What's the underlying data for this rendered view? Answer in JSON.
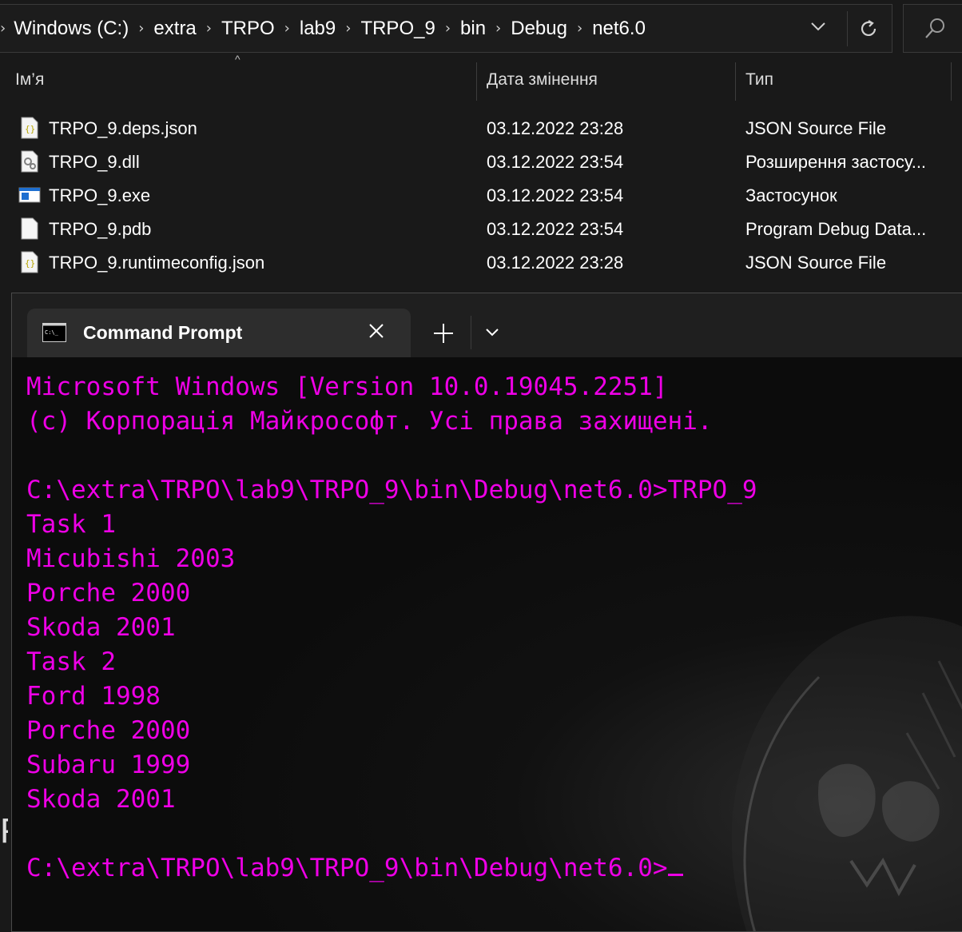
{
  "explorer": {
    "breadcrumbs": [
      "Windows (C:)",
      "extra",
      "TRPO",
      "lab9",
      "TRPO_9",
      "bin",
      "Debug",
      "net6.0"
    ],
    "columns": {
      "name": "Ім’я",
      "date": "Дата змінення",
      "type": "Тип"
    },
    "files": [
      {
        "name": "TRPO_9.deps.json",
        "date": "03.12.2022 23:28",
        "type": "JSON Source File",
        "icon": "json-file-icon"
      },
      {
        "name": "TRPO_9.dll",
        "date": "03.12.2022 23:54",
        "type": "Розширення застосу...",
        "icon": "dll-file-icon"
      },
      {
        "name": "TRPO_9.exe",
        "date": "03.12.2022 23:54",
        "type": "Застосунок",
        "icon": "exe-file-icon"
      },
      {
        "name": "TRPO_9.pdb",
        "date": "03.12.2022 23:54",
        "type": "Program Debug Data...",
        "icon": "blank-file-icon"
      },
      {
        "name": "TRPO_9.runtimeconfig.json",
        "date": "03.12.2022 23:28",
        "type": "JSON Source File",
        "icon": "json-file-icon"
      }
    ]
  },
  "terminal": {
    "tab_title": "Command Prompt",
    "text_color": "#ee00e6",
    "lines": [
      "Microsoft Windows [Version 10.0.19045.2251]",
      "(c) Корпорація Майкрософт. Усі права захищені.",
      "",
      "C:\\extra\\TRPO\\lab9\\TRPO_9\\bin\\Debug\\net6.0>TRPO_9",
      "Task 1",
      "Micubishi 2003",
      "Porche 2000",
      "Skoda 2001",
      "Task 2",
      "Ford 1998",
      "Porche 2000",
      "Subaru 1999",
      "Skoda 2001",
      ""
    ],
    "prompt": "C:\\extra\\TRPO\\lab9\\TRPO_9\\bin\\Debug\\net6.0>"
  },
  "background_fragment": "F"
}
